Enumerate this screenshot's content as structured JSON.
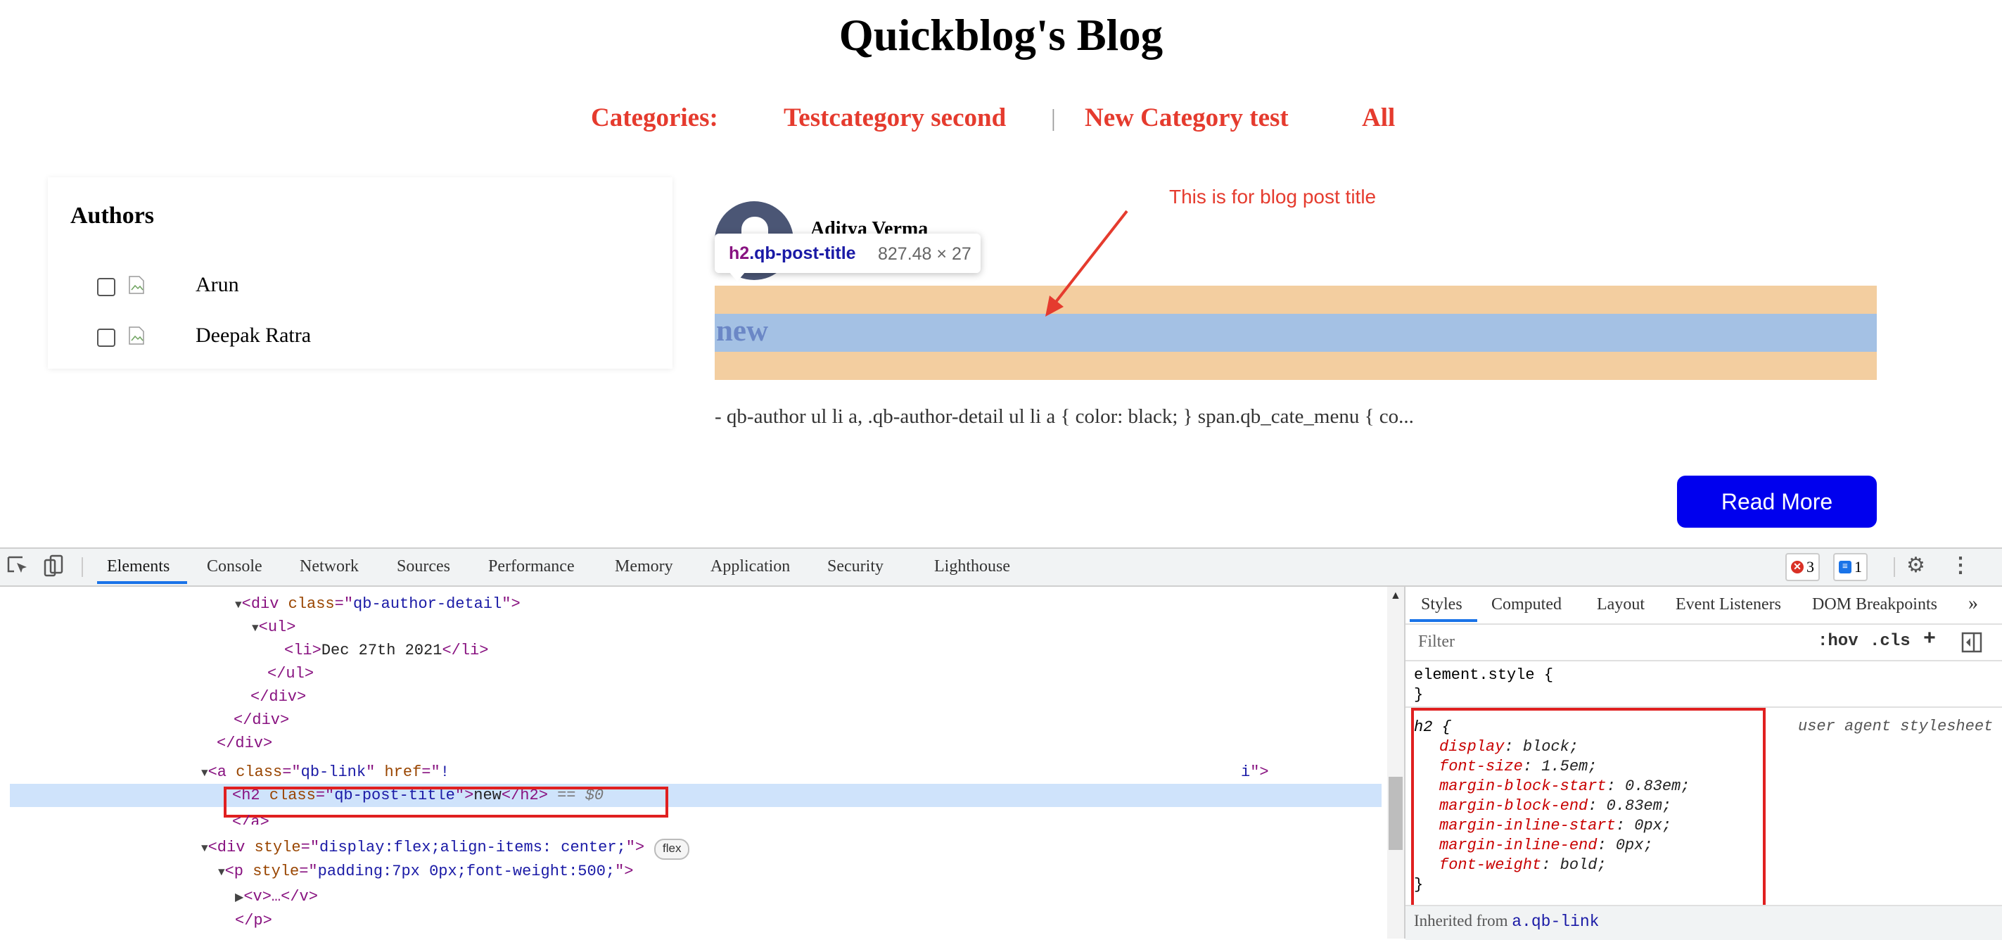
{
  "site": {
    "title": "Quickblog's Blog",
    "categories_label": "Categories:",
    "categories": [
      "Testcategory second",
      "New Category test",
      "All"
    ],
    "separator": "|"
  },
  "authors": {
    "title": "Authors",
    "items": [
      {
        "name": "Arun",
        "checked": false
      },
      {
        "name": "Deepak Ratra",
        "checked": false
      }
    ]
  },
  "post": {
    "author_name": "Aditya Verma",
    "title": "new",
    "excerpt": "- qb-author ul li a, .qb-author-detail ul li a { color: black; } span.qb_cate_menu { co...",
    "read_more": "Read More"
  },
  "inspector_tooltip": {
    "tag": "h2",
    "class": ".qb-post-title",
    "dimensions": "827.48 × 27"
  },
  "annotation": {
    "text": "This is for blog post title",
    "color": "#e53b2e"
  },
  "devtools": {
    "tabs": [
      "Elements",
      "Console",
      "Network",
      "Sources",
      "Performance",
      "Memory",
      "Application",
      "Security",
      "Lighthouse"
    ],
    "active_tab": "Elements",
    "errors_count": "3",
    "messages_count": "1",
    "dom": {
      "line1_tag": "div",
      "line1_attr": "class",
      "line1_val": "qb-author-detail",
      "line2": "ul",
      "line3_text": "Dec 27th 2021",
      "line4": "/ul",
      "line5": "/div",
      "line6": "/div",
      "line7": "/div",
      "line8_attr1": "class",
      "line8_val1": "qb-link",
      "line8_attr2": "href",
      "selected_class": "qb-post-title",
      "selected_text": "new",
      "selected_suffix": "== $0",
      "line10": "/a",
      "line11_style": "display:flex;align-items: center;",
      "flex_badge": "flex",
      "line12_style": "padding:7px 0px;font-weight:500;",
      "line13": "v",
      "line14": "/p"
    },
    "styles": {
      "tabs": [
        "Styles",
        "Computed",
        "Layout",
        "Event Listeners",
        "DOM Breakpoints"
      ],
      "more": "»",
      "filter_placeholder": "Filter",
      "hov": ":hov",
      "cls": ".cls",
      "element_style": "element.style {",
      "rule_selector": "h2 {",
      "rule_source": "user agent stylesheet",
      "declarations": [
        {
          "prop": "display",
          "value": "block;"
        },
        {
          "prop": "font-size",
          "value": "1.5em;"
        },
        {
          "prop": "margin-block-start",
          "value": "0.83em;"
        },
        {
          "prop": "margin-block-end",
          "value": "0.83em;"
        },
        {
          "prop": "margin-inline-start",
          "value": "0px;"
        },
        {
          "prop": "margin-inline-end",
          "value": "0px;"
        },
        {
          "prop": "font-weight",
          "value": "bold;"
        }
      ],
      "inherited_label": "Inherited from",
      "inherited_link": "a.qb-link"
    }
  }
}
